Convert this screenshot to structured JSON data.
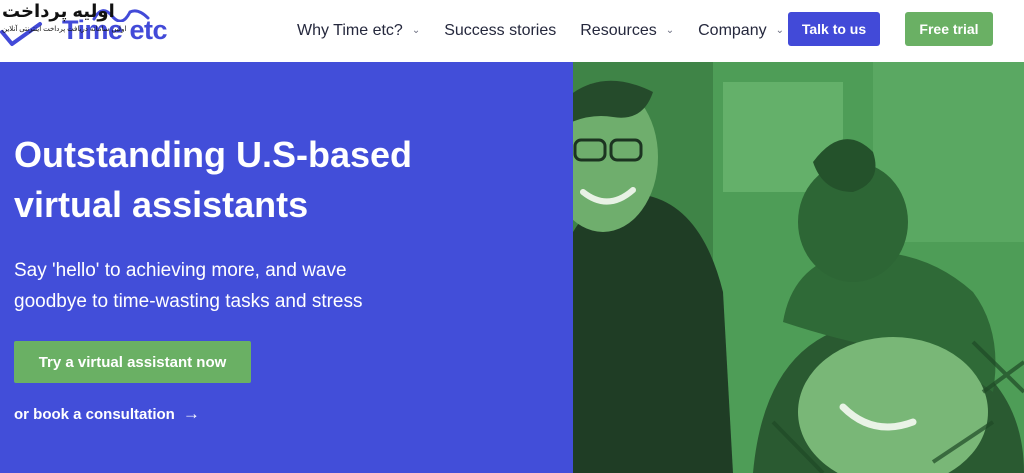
{
  "brand": {
    "name": "Time etc",
    "logo_color": "#424ad8"
  },
  "watermark": {
    "title": "اولیه پرداخت",
    "subtitle": "اولین سامانه دریافت پرداخت اینترنتی آنلاین"
  },
  "nav": {
    "items": [
      {
        "label": "Why Time etc?",
        "has_dropdown": true
      },
      {
        "label": "Success stories",
        "has_dropdown": false
      },
      {
        "label": "Resources",
        "has_dropdown": true
      },
      {
        "label": "Company",
        "has_dropdown": true
      }
    ],
    "dropdown_glyph": "⌄"
  },
  "header_buttons": {
    "talk": "Talk to us",
    "free_trial": "Free trial"
  },
  "hero": {
    "title_line1": "Outstanding U.S-based",
    "title_line2": "virtual assistants",
    "subtitle_line1": "Say 'hello' to achieving more, and wave",
    "subtitle_line2": "goodbye to time-wasting tasks and stress",
    "primary_cta": "Try a virtual assistant now",
    "secondary_cta": "or book a consultation",
    "secondary_arrow": "→",
    "photo_subject": "two-people-smiling-photo"
  },
  "colors": {
    "primary_blue": "#424ed9",
    "accent_green": "#6ab064",
    "photo_tint": "#4d9c55",
    "text_dark": "#25283d"
  }
}
